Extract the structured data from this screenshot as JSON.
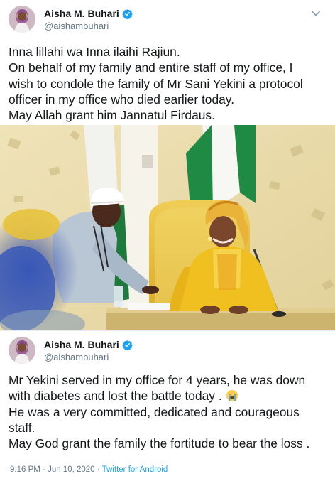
{
  "tweet1": {
    "display_name": "Aisha M. Buhari",
    "handle": "@aishambuhari",
    "lines": [
      "Inna lillahi wa Inna ilaihi Rajiun.",
      "On behalf of my family and entire staff of my office, I",
      "wish to condole the family of Mr Sani Yekini a protocol",
      "officer in my office who died earlier today.",
      "May Allah grant him Jannatul Firdaus."
    ]
  },
  "tweet2": {
    "display_name": "Aisha M. Buhari",
    "handle": "@aishambuhari",
    "lines": [
      "Mr Yekini served in my office for 4 years, he was down",
      "with diabetes and lost the battle today .",
      "He was a very committed, dedicated and courageous",
      "staff.",
      "May God grant the family the fortitude to bear the loss ."
    ],
    "time": "9:16 PM",
    "separator": "·",
    "date": "Jun 10, 2020",
    "source": "Twitter for Android"
  },
  "icons": {
    "verified": "verified-badge-icon",
    "caret": "chevron-down-icon",
    "emoji": "loudly-crying-face-emoji"
  },
  "colors": {
    "text": "#14171a",
    "secondary": "#657786",
    "link": "#1da1f2",
    "verified": "#1da1f2"
  }
}
